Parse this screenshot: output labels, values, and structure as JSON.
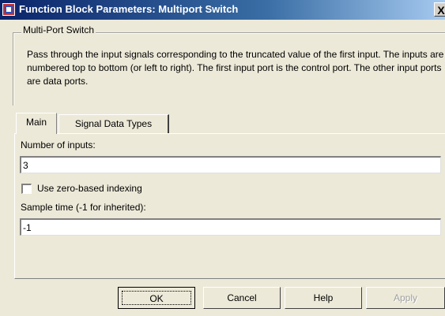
{
  "window": {
    "title": "Function Block Parameters: Multiport Switch",
    "close_label": "X"
  },
  "group": {
    "legend": "Multi-Port Switch",
    "description": "Pass through the input signals corresponding to the truncated value of the first input. The inputs are numbered top to bottom (or left to right). The first input port is the control port. The other input ports are data ports."
  },
  "tabs": [
    {
      "label": "Main",
      "selected": true
    },
    {
      "label": "Signal Data Types",
      "selected": false
    }
  ],
  "main": {
    "num_inputs_label": "Number of inputs:",
    "num_inputs_value": "3",
    "zero_based_label": "Use zero-based indexing",
    "zero_based_checked": false,
    "sample_time_label": "Sample time (-1 for inherited):",
    "sample_time_value": "-1"
  },
  "buttons": {
    "ok": "OK",
    "cancel": "Cancel",
    "help": "Help",
    "apply": "Apply"
  },
  "icons": {
    "window_icon": "simulink-block-icon"
  },
  "colors": {
    "title_bar_start": "#0a246a",
    "title_bar_end": "#a6caf0",
    "dialog_bg": "#ece9d8"
  }
}
